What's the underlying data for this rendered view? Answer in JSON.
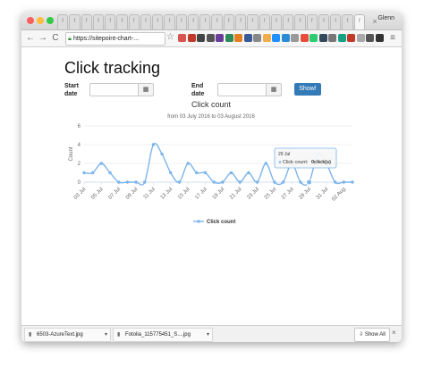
{
  "browser": {
    "user_name": "Glenn",
    "url": "https://sitepoint-chart-...",
    "tab_glyph": "f",
    "new_tab_glyph": "×"
  },
  "page": {
    "title": "Click tracking",
    "start_label": "Start\ndate",
    "end_label": "End\ndate",
    "start_value": "",
    "end_value": "",
    "show_button": "Show!"
  },
  "chart_data": {
    "type": "line",
    "title": "Click count",
    "subtitle": "from 03 July 2016 to 03 August 2016",
    "ylabel": "Count",
    "xlabel": "",
    "ylim": [
      0,
      6
    ],
    "y_ticks": [
      "0",
      "2",
      "4",
      "6"
    ],
    "x": [
      "03 Jul",
      "04 Jul",
      "05 Jul",
      "06 Jul",
      "07 Jul",
      "08 Jul",
      "09 Jul",
      "10 Jul",
      "11 Jul",
      "12 Jul",
      "13 Jul",
      "14 Jul",
      "15 Jul",
      "16 Jul",
      "17 Jul",
      "18 Jul",
      "19 Jul",
      "20 Jul",
      "21 Jul",
      "22 Jul",
      "23 Jul",
      "24 Jul",
      "25 Jul",
      "26 Jul",
      "27 Jul",
      "28 Jul",
      "29 Jul",
      "30 Jul",
      "31 Jul",
      "01 Aug",
      "02 Aug",
      "03 Aug"
    ],
    "x_tick_labels": [
      "03 Jul",
      "05 Jul",
      "07 Jul",
      "09 Jul",
      "11 Jul",
      "13 Jul",
      "15 Jul",
      "17 Jul",
      "19 Jul",
      "21 Jul",
      "23 Jul",
      "25 Jul",
      "27 Jul",
      "29 Jul",
      "31 Jul",
      "02 Aug"
    ],
    "series": [
      {
        "name": "Click count",
        "color": "#7cb5ec",
        "values": [
          1,
          1,
          2,
          1,
          0,
          0,
          0,
          0,
          4,
          3,
          1,
          0,
          2,
          1,
          1,
          0,
          0,
          1,
          0,
          1,
          0,
          2,
          0,
          0,
          2,
          0,
          0,
          3,
          2,
          0,
          0,
          0
        ]
      }
    ],
    "legend": "bottom-center",
    "grid": true,
    "tooltip": {
      "header": "29 Jul",
      "series_label": "Click count:",
      "value_text": "0click(s)"
    }
  },
  "downloads": {
    "items": [
      "6503-AzureText.jpg",
      "Fotolia_115775451_S....jpg"
    ],
    "show_all": "Show All"
  },
  "icons": {
    "back": "←",
    "forward": "→",
    "reload": "C",
    "star": "☆",
    "calendar": "▦",
    "close": "×",
    "menu": "≡",
    "download": "⇩"
  }
}
